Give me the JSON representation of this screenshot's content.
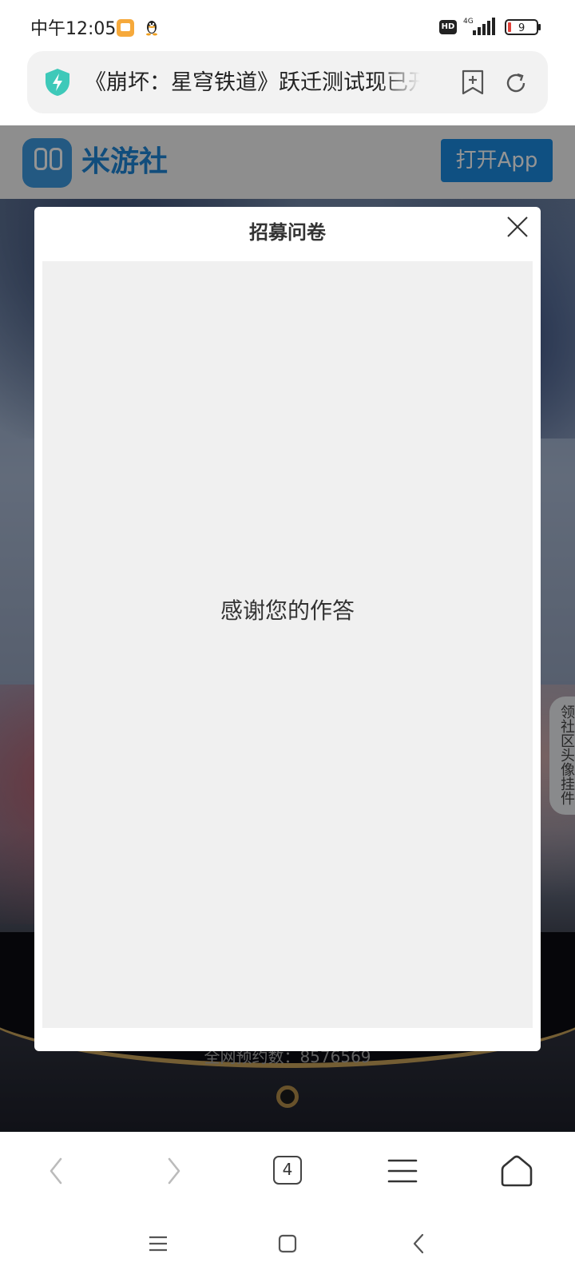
{
  "status_bar": {
    "time": "中午12:05",
    "network": "4G",
    "hd_badge": "HD",
    "battery": "9"
  },
  "url_bar": {
    "title": "《崩坏：星穹铁道》跃迁测试现已开启"
  },
  "site_header": {
    "name": "米游社",
    "open_app_label": "打开App"
  },
  "page": {
    "preorder_count": "全网预约数：8576569",
    "side_tab": "领社区头像挂件"
  },
  "modal": {
    "title": "招募问卷",
    "message": "感谢您的作答"
  },
  "browser_toolbar": {
    "tab_count": "4"
  },
  "colors": {
    "accent": "#1b8ae0",
    "shield": "#3ec9b9",
    "modal_body_bg": "#f0f0f0",
    "battery_low": "#e0413a"
  }
}
